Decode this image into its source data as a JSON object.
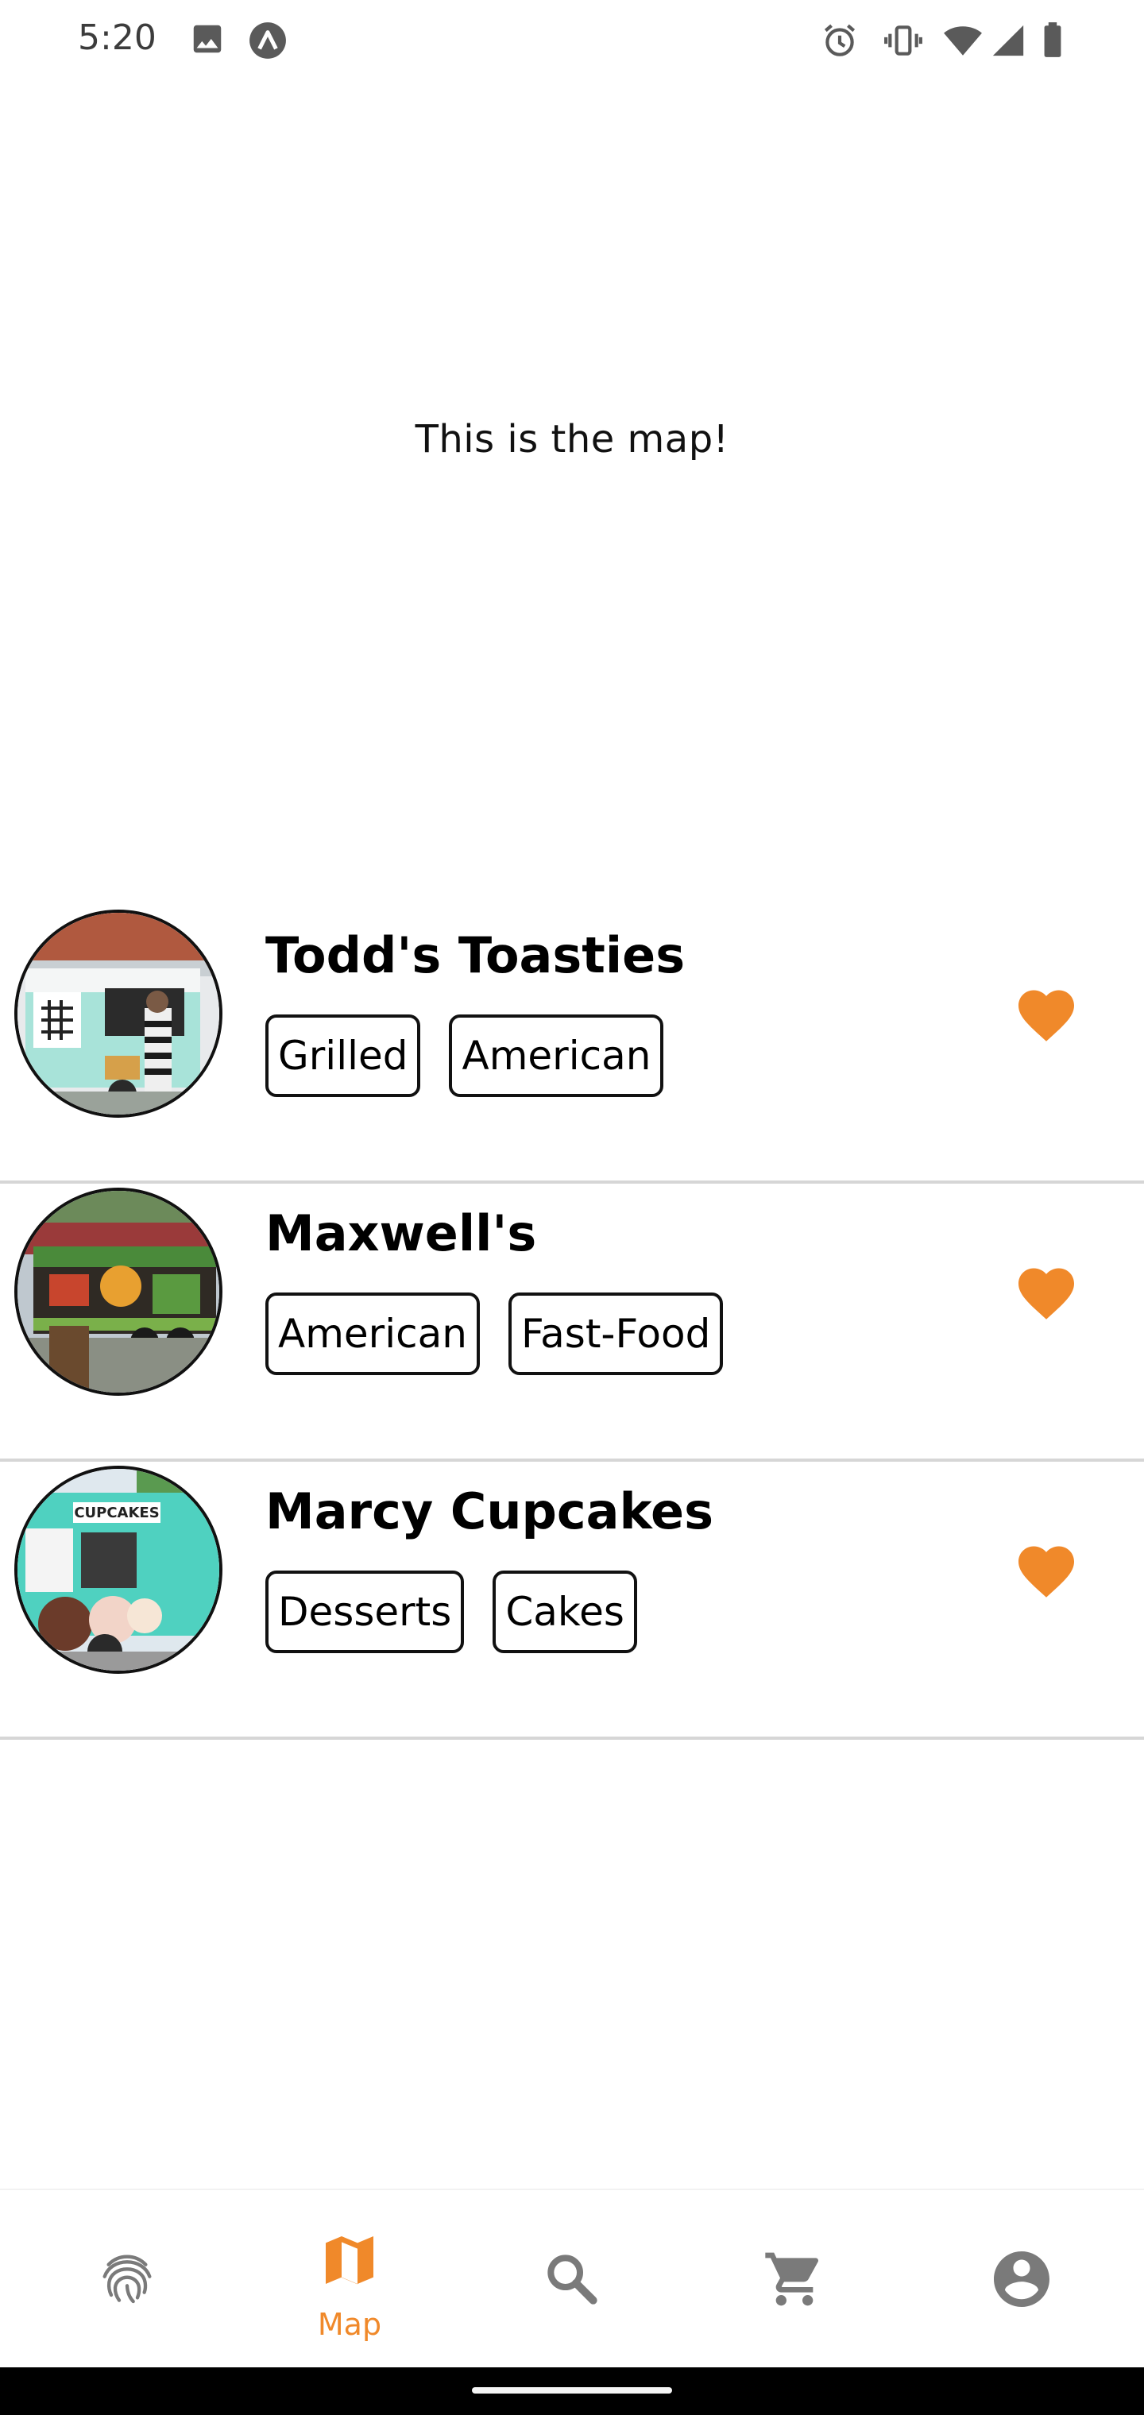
{
  "status_bar": {
    "time": "5:20",
    "icons": [
      "image-icon",
      "app-a-icon",
      "alarm-icon",
      "vibrate-icon",
      "wifi-icon",
      "signal-icon",
      "battery-icon"
    ]
  },
  "map": {
    "placeholder_text": "This is the map!"
  },
  "trucks": [
    {
      "name": "Todd's Toasties",
      "tags": [
        "Grilled",
        "American"
      ],
      "favorite": true
    },
    {
      "name": "Maxwell's",
      "tags": [
        "American",
        "Fast-Food"
      ],
      "favorite": true
    },
    {
      "name": "Marcy Cupcakes",
      "tags": [
        "Desserts",
        "Cakes"
      ],
      "favorite": true
    }
  ],
  "bottom_nav": {
    "items": [
      {
        "icon": "fingerprint-icon",
        "label": ""
      },
      {
        "icon": "map-icon",
        "label": "Map",
        "active": true
      },
      {
        "icon": "search-icon",
        "label": ""
      },
      {
        "icon": "cart-icon",
        "label": ""
      },
      {
        "icon": "account-icon",
        "label": ""
      }
    ]
  },
  "colors": {
    "accent": "#f0892a",
    "divider": "#d6d6d6",
    "inactive_icon": "#7a7a7a"
  }
}
